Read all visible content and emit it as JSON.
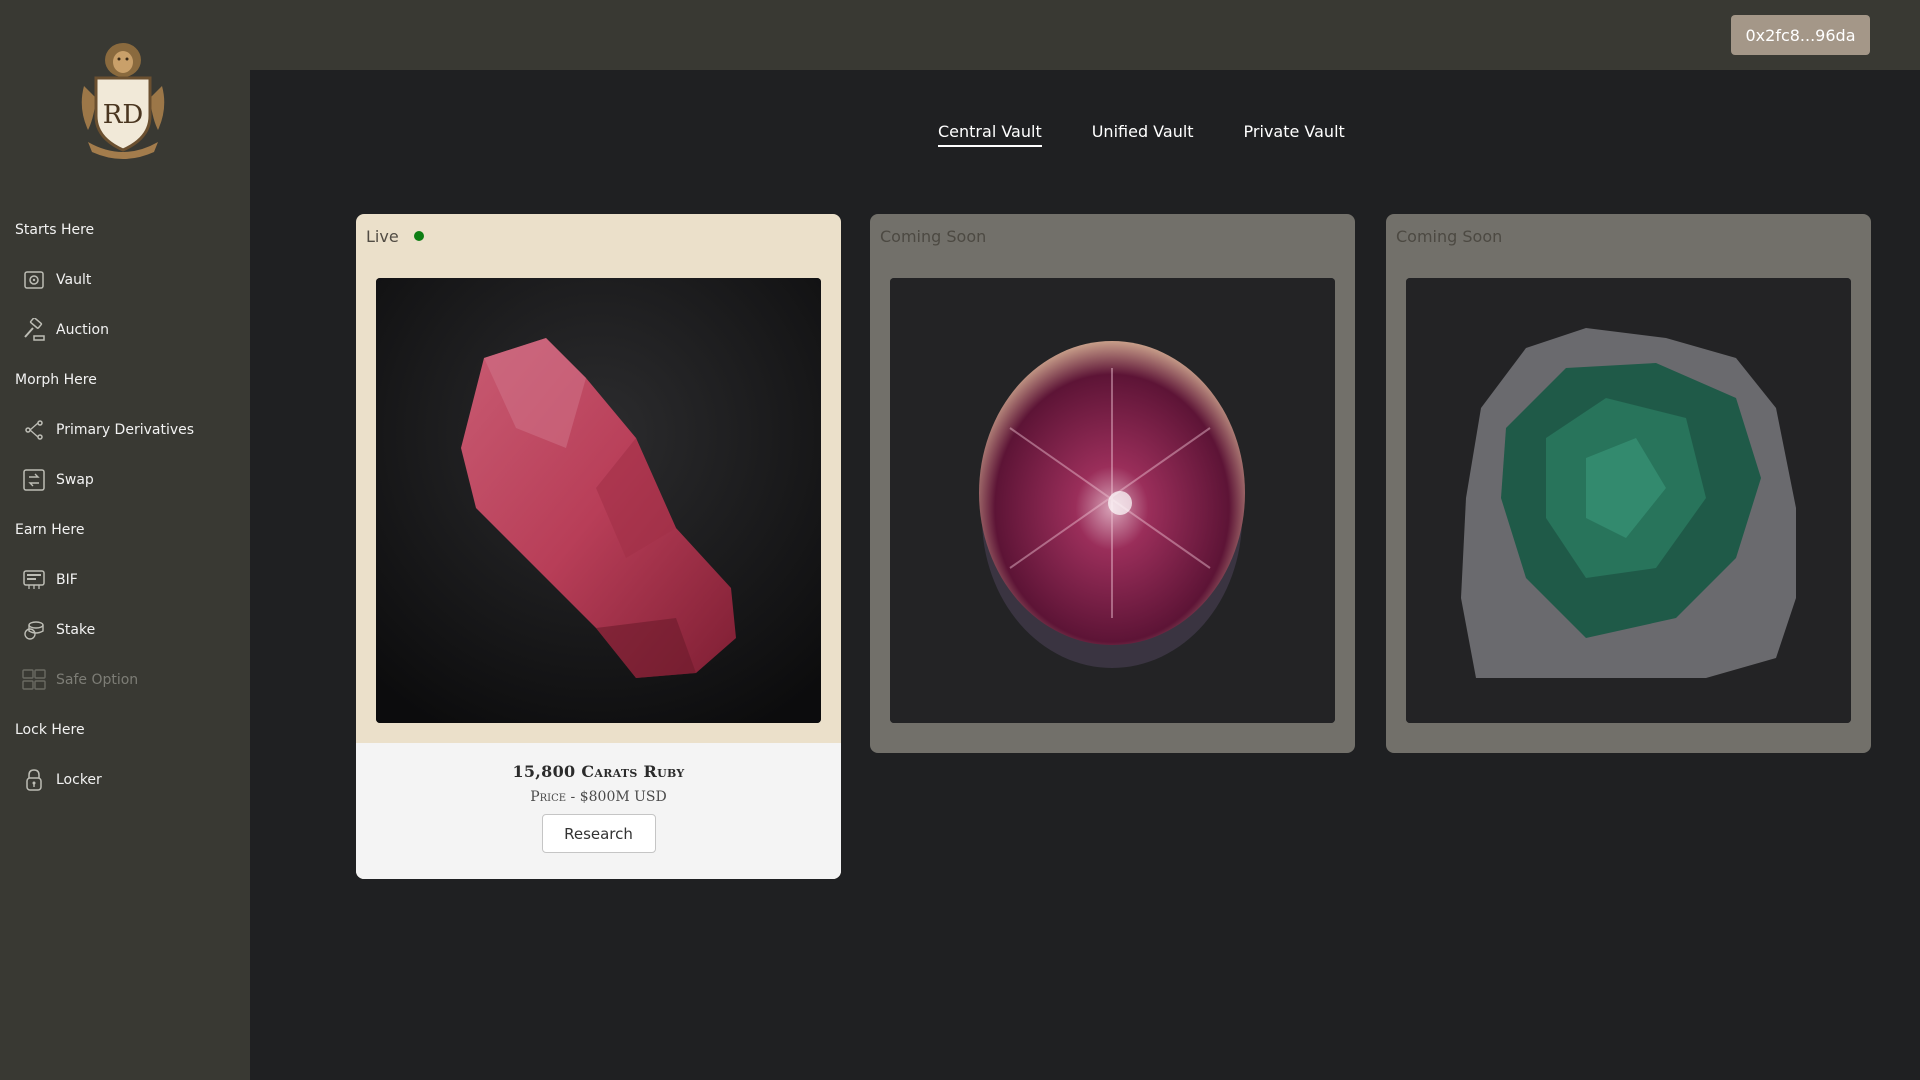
{
  "header": {
    "wallet_address": "0x2fc8...96da"
  },
  "sidebar": {
    "logo_alt": "RD",
    "sections": [
      {
        "label": "Starts Here",
        "items": [
          {
            "label": "Vault",
            "icon": "vault-icon"
          },
          {
            "label": "Auction",
            "icon": "gavel-icon"
          }
        ]
      },
      {
        "label": "Morph Here",
        "items": [
          {
            "label": "Primary Derivatives",
            "icon": "branch-icon"
          },
          {
            "label": "Swap",
            "icon": "swap-icon"
          }
        ]
      },
      {
        "label": "Earn Here",
        "items": [
          {
            "label": "BIF",
            "icon": "bif-icon"
          },
          {
            "label": "Stake",
            "icon": "stake-icon"
          },
          {
            "label": "Safe Option",
            "icon": "safe-option-icon",
            "disabled": true
          }
        ]
      },
      {
        "label": "Lock Here",
        "items": [
          {
            "label": "Locker",
            "icon": "lock-icon"
          }
        ]
      }
    ]
  },
  "tabs": [
    {
      "label": "Central Vault",
      "active": true
    },
    {
      "label": "Unified Vault",
      "active": false
    },
    {
      "label": "Private Vault",
      "active": false
    }
  ],
  "cards": [
    {
      "status": "Live",
      "image": "rough-ruby",
      "title": "15,800 Carats Ruby",
      "price": "Price - $800M USD",
      "button": "Research"
    },
    {
      "status": "Coming Soon",
      "image": "star-ruby-cabochon"
    },
    {
      "status": "Coming Soon",
      "image": "emerald-in-matrix"
    }
  ],
  "colors": {
    "sidebar_bg": "#393933",
    "main_bg": "#1f2022",
    "live_card_bg": "#ebe0ca",
    "soon_card_bg": "#72706a",
    "wallet_btn_bg": "#a49788",
    "live_dot": "#0e7e14"
  }
}
